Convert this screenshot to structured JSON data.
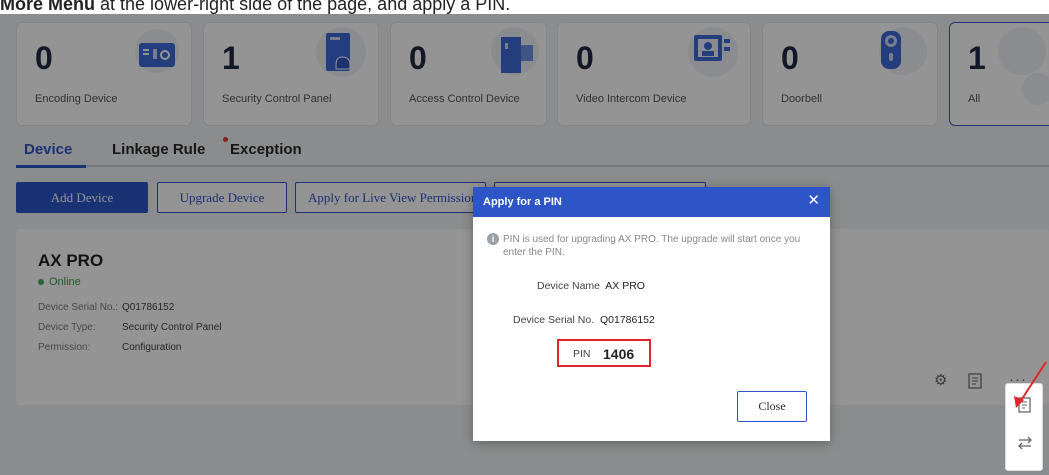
{
  "caption": {
    "bold_text": "More Menu",
    "rest_text": " at the lower-right side of the page, and apply a PIN."
  },
  "cards": [
    {
      "count": "0",
      "label": "Encoding Device",
      "icon": "encoder-device-icon"
    },
    {
      "count": "1",
      "label": "Security Control Panel",
      "icon": "security-panel-icon"
    },
    {
      "count": "0",
      "label": "Access Control Device",
      "icon": "access-control-icon"
    },
    {
      "count": "0",
      "label": "Video Intercom Device",
      "icon": "video-intercom-icon"
    },
    {
      "count": "0",
      "label": "Doorbell",
      "icon": "doorbell-icon"
    },
    {
      "count": "1",
      "label": "All",
      "icon": ""
    }
  ],
  "tabs": [
    {
      "label": "Device",
      "active": true
    },
    {
      "label": "Linkage Rule",
      "active": false
    },
    {
      "label": "Exception",
      "active": false,
      "has_badge": true
    }
  ],
  "toolbar": {
    "add_device": "Add Device",
    "upgrade_device": "Upgrade Device",
    "apply_live_view": "Apply for Live View Permission"
  },
  "device": {
    "name": "AX PRO",
    "status": "Online",
    "serial_label": "Device Serial No.:",
    "serial_value": "Q01786152",
    "type_label": "Device Type:",
    "type_value": "Security Control Panel",
    "permission_label": "Permission:",
    "permission_value": "Configuration"
  },
  "modal": {
    "title": "Apply for a PIN",
    "info": "PIN is used for upgrading AX PRO. The upgrade will start once you enter the PIN.",
    "device_name_label": "Device Name",
    "device_name_value": "AX PRO",
    "serial_label": "Device Serial No.",
    "serial_value": "Q01786152",
    "pin_label": "PIN",
    "pin_value": "1406",
    "close_label": "Close"
  },
  "colors": {
    "primary": "#2d55c7",
    "highlight_red": "#e0262b",
    "online_green": "#3cb05a"
  }
}
